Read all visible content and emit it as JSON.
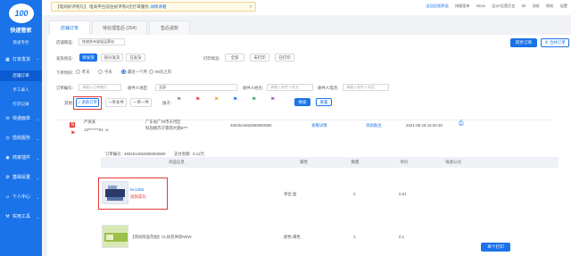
{
  "app": {
    "logo_text": "100",
    "brand": "快递管家"
  },
  "sidebar": {
    "items": [
      {
        "label": "快递专栏",
        "icon": "",
        "type": "sub",
        "active": false
      },
      {
        "label": "打单发货",
        "icon": "▦",
        "type": "group"
      },
      {
        "label": "店铺订单",
        "icon": "",
        "type": "sub",
        "active": true
      },
      {
        "label": "手工录入",
        "icon": "",
        "type": "sub",
        "active": false
      },
      {
        "label": "打印记录",
        "icon": "",
        "type": "sub",
        "active": false
      },
      {
        "label": "快递面单",
        "icon": "✉",
        "type": "group"
      },
      {
        "label": "揽收服务",
        "icon": "◷",
        "type": "group"
      },
      {
        "label": "商家插件",
        "icon": "◉",
        "type": "group"
      },
      {
        "label": "基础设置",
        "icon": "⚙",
        "type": "group"
      },
      {
        "label": "个人中心",
        "icon": "☺",
        "type": "group"
      },
      {
        "label": "实用工具",
        "icon": "⚒",
        "type": "group"
      }
    ]
  },
  "topbar": {
    "notice_prefix": "【电商好评有礼】 电商平台前往好评有0元打单服务,",
    "notice_link": "详情请看",
    "links": [
      "返回旧版界面",
      "快捷菜单",
      "Inbox",
      "设计/运营后台",
      "消息",
      "帮助",
      "设置"
    ],
    "badge": "50"
  },
  "tabs": [
    "店铺订单",
    "待处理售后 (204)",
    "售后退款"
  ],
  "filters": {
    "shop_label": "店铺筛选:",
    "shop_value": "快递苏州省轻运营站",
    "send_status_label": "发货状态:",
    "send_status_options": [
      "待发货",
      "部分发货",
      "已发货"
    ],
    "print_status_label": "打印状态:",
    "print_status_options": [
      "全部",
      "未打印",
      "已打印"
    ],
    "time_label": "下单时间:",
    "time_options": [
      "昨天",
      "今天",
      "最近一个月",
      "90天之内"
    ],
    "time_selected": 2,
    "order_no_label": "订单编号:",
    "order_no_placeholder": "请输入订单编号",
    "receiver_region_label": "收件人地区:",
    "receiver_region_value": "全部",
    "receiver_name_label": "收件人姓名:",
    "receiver_name_placeholder": "请输入收件人姓名",
    "receiver_phone_label": "收件人电话:",
    "receiver_phone_placeholder": "请输入收件人电话",
    "other_label": "其他:",
    "other_checked": "退款订单",
    "other_options": [
      "一单多件",
      "一单一件"
    ],
    "flag_label": "旗子:",
    "search_button": "搜索",
    "reset_button": "重置"
  },
  "actions": {
    "sync_button": "同步订单",
    "merge_button": "合并订单"
  },
  "order": {
    "tag": "淘",
    "receiver": "严某某",
    "phone": "13*******61 ☏",
    "address_line1": "广东省广州市天河区",
    "address_line2": "科韵路苏宁雷雨大厦B***",
    "order_number_short": "4832544652869050580",
    "detail_link": "查看详情",
    "remark": "添加备注",
    "time": "2021-06-18 16:34:48",
    "full_number_label": "订单编号:",
    "full_number": "4832544652869050580",
    "payment_label": "支付金额:",
    "payment": "0.12元"
  },
  "table": {
    "headers": [
      "商品信息",
      "属性",
      "数量",
      "单价",
      "快递公司"
    ],
    "rows": [
      {
        "name": "lvc1366",
        "status": "退款成功",
        "attr": "单位:盒",
        "qty": "2",
        "price": "0.01"
      },
      {
        "name": "【测试商品勿拍】CL扶贫体验NEW",
        "status": "",
        "attr": "颜色:褐色",
        "qty": "1",
        "price": "0.1"
      }
    ]
  },
  "footer_button": "单个打印",
  "colors": {
    "primary": "#1a73e8",
    "highlight": "#e53935"
  }
}
